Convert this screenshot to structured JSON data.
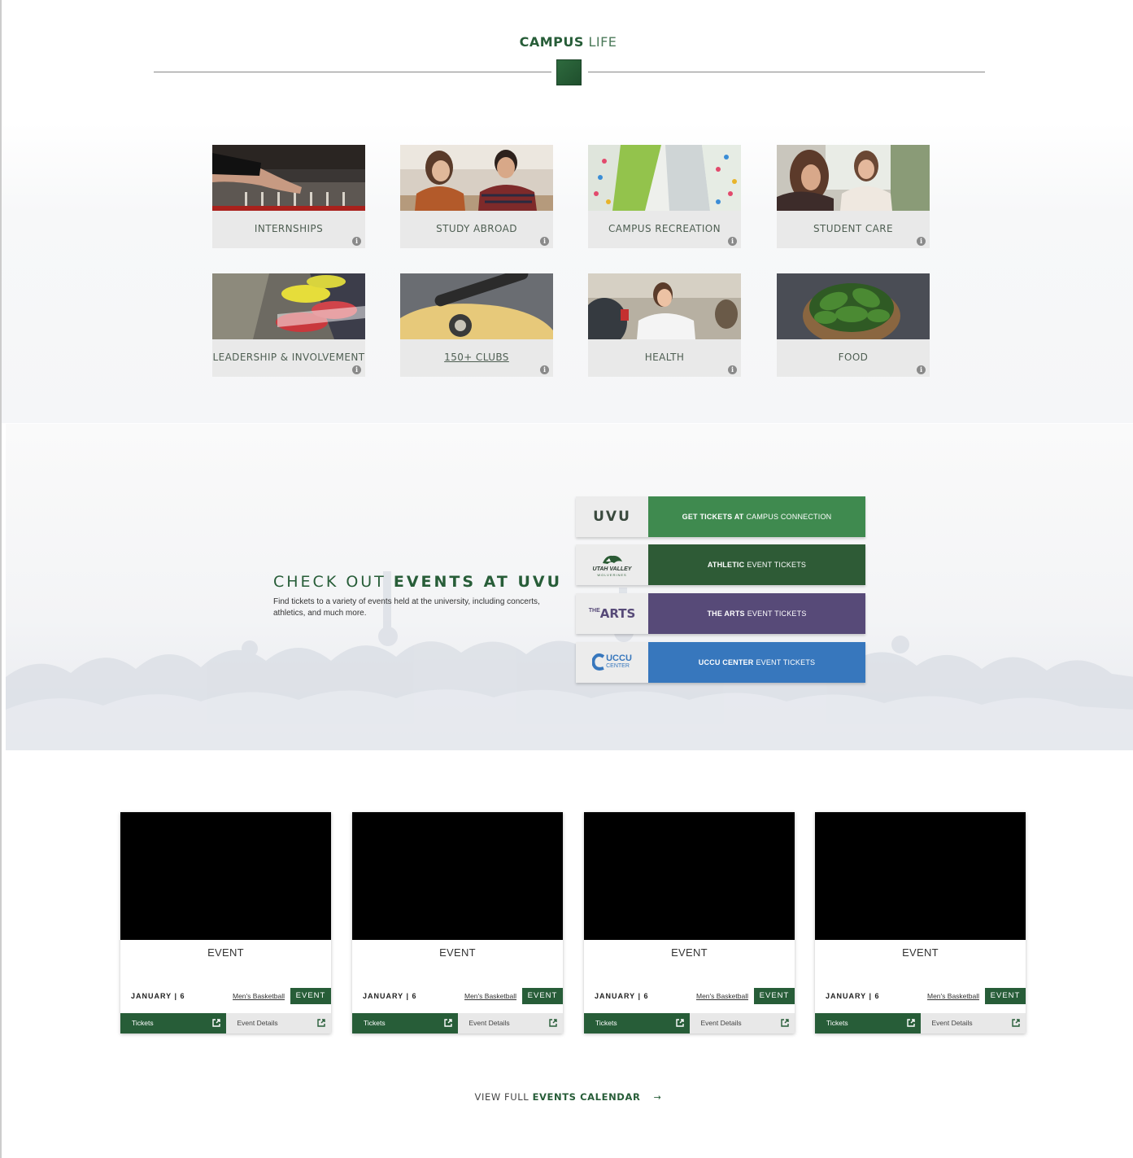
{
  "campus_life": {
    "title_bold": "CAMPUS",
    "title_light": "LIFE",
    "tiles": [
      {
        "label": "INTERNSHIPS",
        "info": "i"
      },
      {
        "label": "STUDY ABROAD",
        "info": "i"
      },
      {
        "label": "CAMPUS RECREATION",
        "info": "i"
      },
      {
        "label": "STUDENT CARE",
        "info": "i"
      },
      {
        "label": "LEADERSHIP & INVOLVEMENT",
        "info": "i"
      },
      {
        "label": "150+ CLUBS",
        "info": "i"
      },
      {
        "label": "HEALTH",
        "info": "i"
      },
      {
        "label": "FOOD",
        "info": "i"
      }
    ]
  },
  "events_banner": {
    "heading_light": "CHECK OUT",
    "heading_bold": "EVENTS AT UVU",
    "subtext": "Find tickets to a variety of events held at the university, including concerts, athletics, and much more.",
    "ticket_links": [
      {
        "logo": "UVU",
        "bold": "GET TICKETS AT",
        "light": "CAMPUS CONNECTION",
        "color": "#3f8a4f"
      },
      {
        "logo": "UTAH VALLEY",
        "logo_sub": "WOLVERINES",
        "bold": "ATHLETIC",
        "light": "EVENT TICKETS",
        "color": "#2e5b36"
      },
      {
        "logo_small": "THE",
        "logo": "ARTS",
        "bold": "THE ARTS",
        "light": "EVENT TICKETS",
        "color": "#574a78"
      },
      {
        "logo": "UCCU",
        "logo_sub": "CENTER",
        "bold": "UCCU CENTER",
        "light": "EVENT TICKETS",
        "color": "#3777bd"
      }
    ]
  },
  "event_cards": [
    {
      "title": "EVENT",
      "date": "JANUARY | 6",
      "category": "Men's Basketball",
      "tag": "EVENT",
      "tickets": "Tickets",
      "details": "Event Details"
    },
    {
      "title": "EVENT",
      "date": "JANUARY | 6",
      "category": "Men's Basketball",
      "tag": "EVENT",
      "tickets": "Tickets",
      "details": "Event Details"
    },
    {
      "title": "EVENT",
      "date": "JANUARY | 6",
      "category": "Men's Basketball",
      "tag": "EVENT",
      "tickets": "Tickets",
      "details": "Event Details"
    },
    {
      "title": "EVENT",
      "date": "JANUARY | 6",
      "category": "Men's Basketball",
      "tag": "EVENT",
      "tickets": "Tickets",
      "details": "Event Details"
    }
  ],
  "view_all": {
    "light": "VIEW FULL",
    "bold": "EVENTS CALENDAR",
    "arrow": "→"
  },
  "colors": {
    "brand_green": "#275d38",
    "tile_bg": "#e9e9e9"
  }
}
